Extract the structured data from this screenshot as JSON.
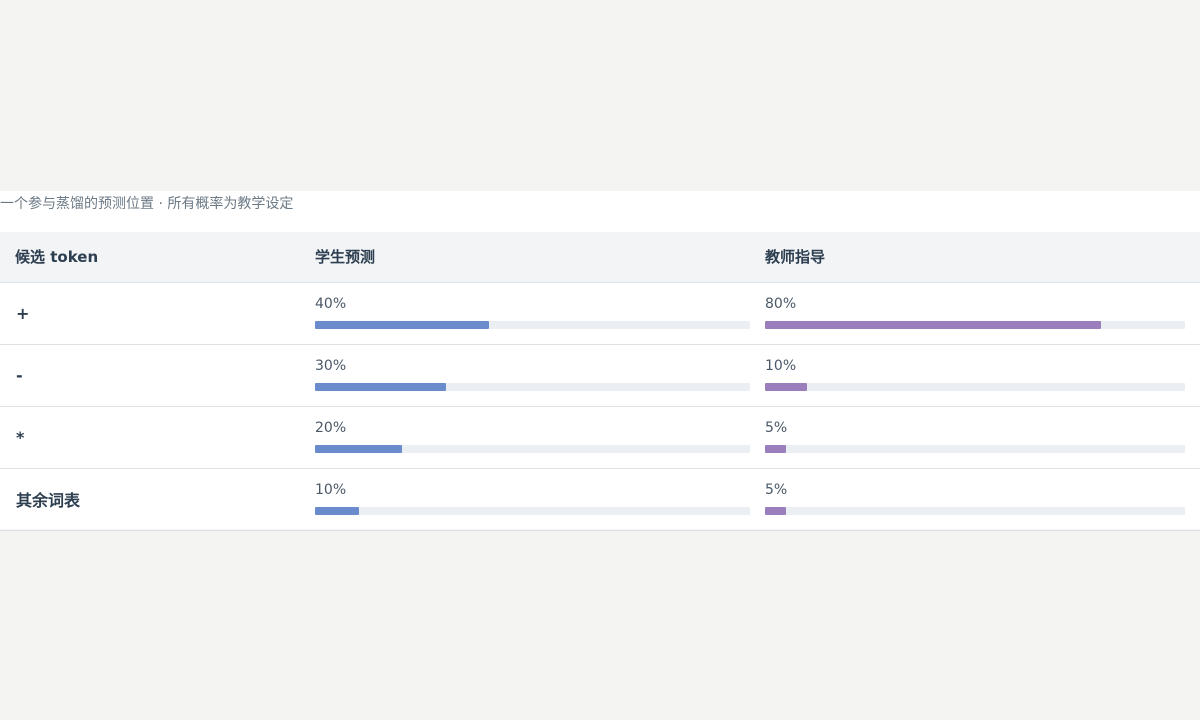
{
  "caption": "一个参与蒸馏的预测位置 · 所有概率为教学设定",
  "table": {
    "headers": [
      "候选 token",
      "学生预测",
      "教师指导"
    ],
    "rows": [
      {
        "token": "+",
        "student": {
          "label": "40%",
          "value": 0.4
        },
        "teacher": {
          "label": "80%",
          "value": 0.8
        }
      },
      {
        "token": "-",
        "student": {
          "label": "30%",
          "value": 0.3
        },
        "teacher": {
          "label": "10%",
          "value": 0.1
        }
      },
      {
        "token": "*",
        "student": {
          "label": "20%",
          "value": 0.2
        },
        "teacher": {
          "label": "5%",
          "value": 0.05
        }
      },
      {
        "token": "其余词表",
        "student": {
          "label": "10%",
          "value": 0.1
        },
        "teacher": {
          "label": "5%",
          "value": 0.05
        }
      }
    ]
  },
  "colors": {
    "student": "#6b8ccc",
    "teacher": "#9b7ebc",
    "track": "#ebeef2"
  }
}
